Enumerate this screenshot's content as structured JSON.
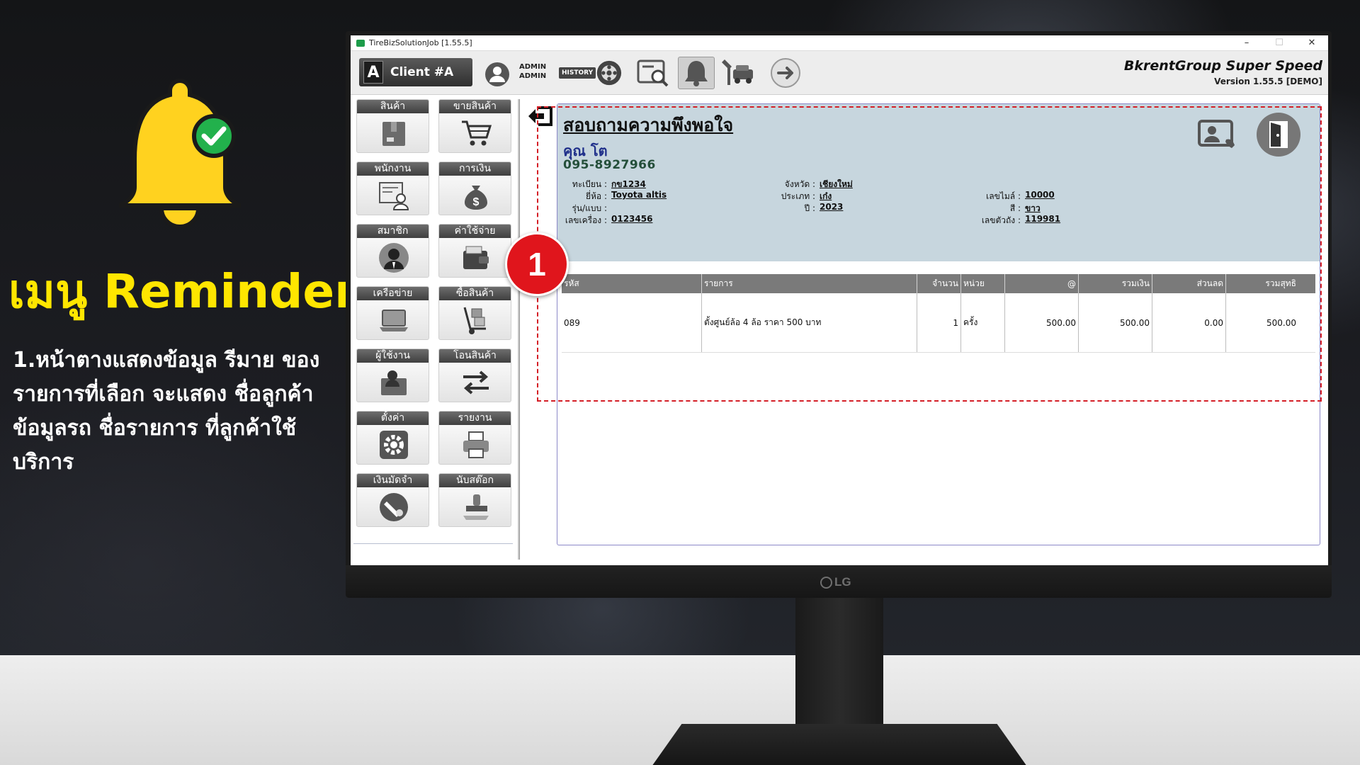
{
  "promo": {
    "title": "เมนู Reminder",
    "description": "1.หน้าตางแสดงข้อมูล รีมาย ของรายการที่เลือก จะแสดง ชื่อลูกค้า ข้อมูลรถ ชื่อรายการ ที่ลูกค้าใช้บริการ",
    "badge": "1"
  },
  "window": {
    "title": "TireBizSolutionJob [1.55.5]",
    "controls": [
      "–",
      "☐",
      "✕"
    ]
  },
  "toolbar": {
    "client_letter": "A",
    "client_label": "Client #A",
    "user_line1": "ADMIN",
    "user_line2": "ADMIN",
    "history_label": "HISTORY",
    "brand": "BkrentGroup Super Speed",
    "version": "Version 1.55.5 [DEMO]"
  },
  "sidebar": {
    "items": [
      {
        "label": "สินค้า",
        "icon": "box-icon"
      },
      {
        "label": "ขายสินค้า",
        "icon": "cart-icon"
      },
      {
        "label": "พนักงาน",
        "icon": "employee-icon"
      },
      {
        "label": "การเงิน",
        "icon": "money-bag-icon"
      },
      {
        "label": "สมาชิก",
        "icon": "member-icon"
      },
      {
        "label": "ค่าใช้จ่าย",
        "icon": "wallet-icon"
      },
      {
        "label": "เครือข่าย",
        "icon": "laptop-icon"
      },
      {
        "label": "ซื้อสินค้า",
        "icon": "hand-truck-icon"
      },
      {
        "label": "ผู้ใช้งาน",
        "icon": "user-folder-icon"
      },
      {
        "label": "โอนสินค้า",
        "icon": "transfer-icon"
      },
      {
        "label": "ตั้งค่า",
        "icon": "gear-icon"
      },
      {
        "label": "รายงาน",
        "icon": "printer-icon"
      },
      {
        "label": "เงินมัดจำ",
        "icon": "deposit-icon"
      },
      {
        "label": "นับสต๊อก",
        "icon": "stamp-icon"
      }
    ]
  },
  "reminder": {
    "title": "สอบถามความพึงพอใจ",
    "customer_name": "คุณ โต",
    "phone": "095-8927966",
    "vehicle": {
      "plate_label": "ทะเบียน :",
      "plate": "กข1234",
      "brand_label": "ยี่ห้อ :",
      "brand": "Toyota altis",
      "model_label": "รุ่น/แบบ :",
      "model": "",
      "engine_label": "เลขเครื่อง :",
      "engine": "0123456",
      "province_label": "จังหวัด :",
      "province": "เชียงใหม่",
      "type_label": "ประเภท :",
      "type": "เก๋ง",
      "year_label": "ปี :",
      "year": "2023",
      "mileage_label": "เลขไมล์ :",
      "mileage": "10000",
      "color_label": "สี :",
      "color": "ขาว",
      "chassis_label": "เลขตัวถัง :",
      "chassis": "119981"
    },
    "table": {
      "headers": [
        "รหัส",
        "รายการ",
        "จำนวน",
        "หน่วย",
        "@",
        "รวมเงิน",
        "ส่วนลด",
        "รวมสุทธิ"
      ],
      "rows": [
        [
          "089",
          "ตั้งศูนย์ล้อ 4 ล้อ ราคา 500 บาท",
          "1",
          "ครั้ง",
          "500.00",
          "500.00",
          "0.00",
          "500.00"
        ]
      ]
    }
  },
  "colors": {
    "accent_yellow": "#ffe600",
    "highlight_red": "#d41e26",
    "header_bg": "#c7d6de",
    "name_blue": "#1f2f8a",
    "phone_green": "#244f3a"
  }
}
